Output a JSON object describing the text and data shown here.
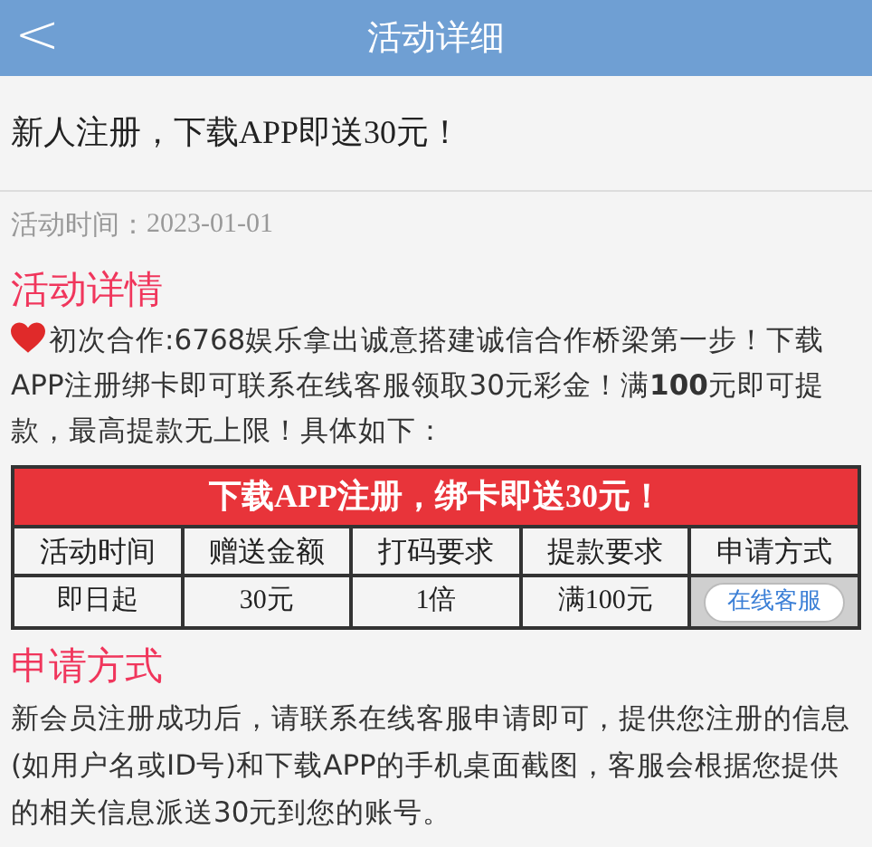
{
  "header": {
    "back": "<",
    "title": "活动详细"
  },
  "headline": "新人注册，下载APP即送30元！",
  "date": {
    "label": "活动时间：",
    "value": "2023-01-01"
  },
  "details": {
    "heading": "活动详情",
    "paragraph": "初次合作:6768娱乐拿出诚意搭建诚信合作桥梁第一步！下载APP注册绑卡即可联系在线客服领取30元彩金！满**100**元即可提款，最高提款无上限！具体如下："
  },
  "table": {
    "banner": "下载APP注册，绑卡即送30元！",
    "columns": [
      "活动时间",
      "赠送金额",
      "打码要求",
      "提款要求",
      "申请方式"
    ],
    "row": [
      {
        "kind": "text",
        "text": "即日起"
      },
      {
        "kind": "text",
        "text": "30元"
      },
      {
        "kind": "text",
        "text": "1倍"
      },
      {
        "kind": "text",
        "text": "满100元"
      },
      {
        "kind": "button",
        "text": "在线客服"
      }
    ]
  },
  "apply": {
    "heading": "申请方式",
    "paragraph": "新会员注册成功后，请联系在线客服申请即可，提供您注册的信息(如用户名或ID号)和下载APP的手机桌面截图，客服会根据您提供的相关信息派送30元到您的账号。"
  }
}
